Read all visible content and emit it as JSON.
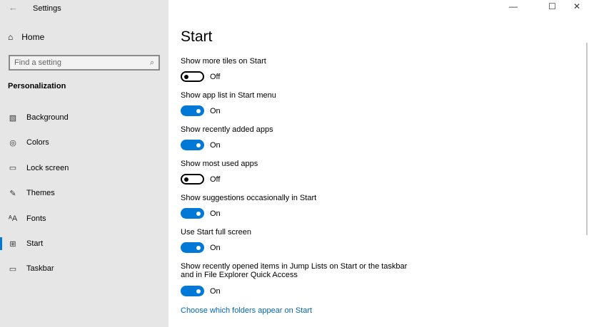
{
  "window": {
    "title": "Settings",
    "back_icon": "←",
    "min_icon": "—",
    "max_icon": "☐",
    "close_icon": "✕"
  },
  "sidebar": {
    "home": "Home",
    "search_placeholder": "Find a setting",
    "section": "Personalization",
    "items": [
      {
        "label": "Background",
        "icon": "▧"
      },
      {
        "label": "Colors",
        "icon": "◎"
      },
      {
        "label": "Lock screen",
        "icon": "▭"
      },
      {
        "label": "Themes",
        "icon": "✎"
      },
      {
        "label": "Fonts",
        "icon": "ᴬA"
      },
      {
        "label": "Start",
        "icon": "⊞"
      },
      {
        "label": "Taskbar",
        "icon": "▭"
      }
    ],
    "active": "Start"
  },
  "main": {
    "title": "Start",
    "settings": [
      {
        "label": "Show more tiles on Start",
        "state": "Off",
        "on": false
      },
      {
        "label": "Show app list in Start menu",
        "state": "On",
        "on": true
      },
      {
        "label": "Show recently added apps",
        "state": "On",
        "on": true
      },
      {
        "label": "Show most used apps",
        "state": "Off",
        "on": false
      },
      {
        "label": "Show suggestions occasionally in Start",
        "state": "On",
        "on": true
      },
      {
        "label": "Use Start full screen",
        "state": "On",
        "on": true
      },
      {
        "label": "Show recently opened items in Jump Lists on Start or the taskbar and in File Explorer Quick Access",
        "state": "On",
        "on": true
      }
    ],
    "link": "Choose which folders appear on Start"
  },
  "colors": {
    "accent": "#0078d7",
    "link": "#0067b8"
  }
}
